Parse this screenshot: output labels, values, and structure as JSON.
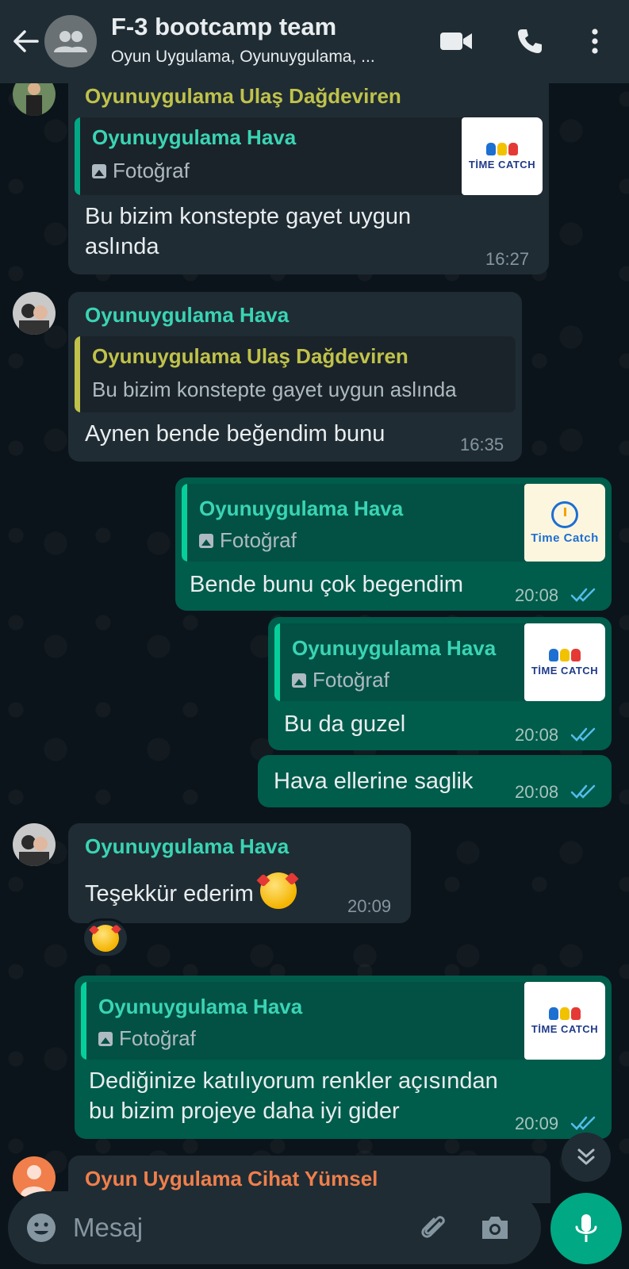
{
  "header": {
    "title": "F-3 bootcamp team",
    "subtitle": "Oyun Uygulama, Oyunuygulama, ..."
  },
  "colors": {
    "header_bg": "#1f2c34",
    "incoming_bubble": "#1f2c34",
    "outgoing_bubble": "#005c4b",
    "accent_green": "#00a884",
    "sender_olive": "#c0c24a",
    "sender_teal": "#3ad4b4",
    "sender_orange": "#f07f4b",
    "read_ticks": "#53bdeb"
  },
  "messages": [
    {
      "direction": "in",
      "sender": "Oyunuygulama Ulaş Dağdeviren",
      "quote": {
        "name": "Oyunuygulama Hava",
        "text": "Fotoğraf",
        "thumb": "TİME CATCH"
      },
      "lines": [
        "Bu bizim konstepte gayet uygun",
        "aslında"
      ],
      "time": "16:27"
    },
    {
      "direction": "in",
      "sender": "Oyunuygulama Hava",
      "quote": {
        "name": "Oyunuygulama Ulaş Dağdeviren",
        "text": "Bu bizim konstepte gayet uygun aslında"
      },
      "lines": [
        "Aynen bende beğendim bunu"
      ],
      "time": "16:35"
    },
    {
      "direction": "out",
      "quote": {
        "name": "Oyunuygulama Hava",
        "text": "Fotoğraf",
        "thumb": "Time Catch"
      },
      "lines": [
        "Bende bunu çok begendim"
      ],
      "time": "20:08"
    },
    {
      "direction": "out",
      "quote": {
        "name": "Oyunuygulama Hava",
        "text": "Fotoğraf",
        "thumb": "TİME CATCH"
      },
      "lines": [
        "Bu da guzel"
      ],
      "time": "20:08"
    },
    {
      "direction": "out",
      "lines": [
        "Hava ellerine saglik"
      ],
      "time": "20:08"
    },
    {
      "direction": "in",
      "sender": "Oyunuygulama Hava",
      "lines": [
        "Teşekkür ederim"
      ],
      "time": "20:09",
      "emoji": "smiling-face-with-hearts"
    },
    {
      "direction": "out",
      "quote": {
        "name": "Oyunuygulama Hava",
        "text": "Fotoğraf",
        "thumb": "TİME CATCH"
      },
      "lines": [
        "Dediğinize katılıyorum renkler açısından",
        "bu bizim projeye daha iyi gider"
      ],
      "time": "20:09"
    }
  ],
  "partial_message": {
    "sender": "Oyun Uygulama Cihat Yümsel"
  },
  "input": {
    "placeholder": "Mesaj"
  },
  "icons": {
    "back": "arrow-left-icon",
    "group": "group-avatar-icon",
    "video": "video-call-icon",
    "call": "phone-icon",
    "menu": "more-vert-icon",
    "emoji": "emoji-icon",
    "attach": "paperclip-icon",
    "camera": "camera-icon",
    "mic": "mic-icon",
    "scroll": "double-chevron-down-icon"
  }
}
